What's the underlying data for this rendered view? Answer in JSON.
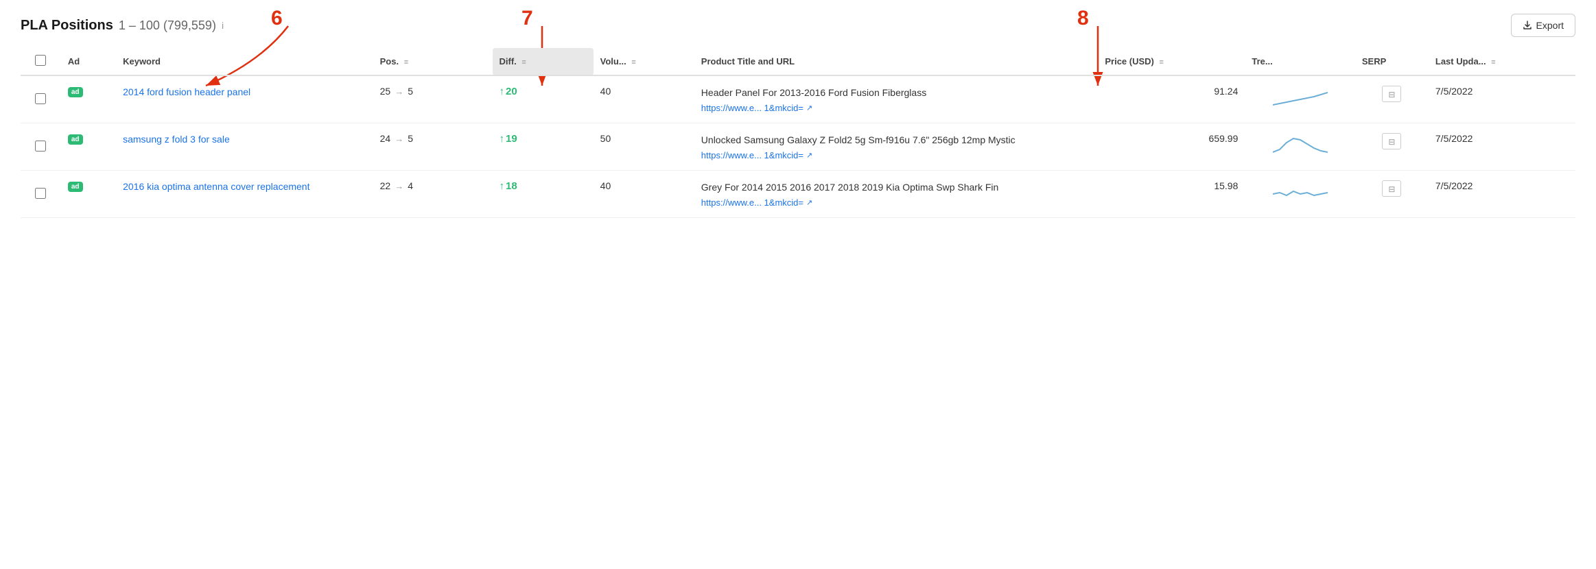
{
  "header": {
    "title": "PLA Positions",
    "range": "1 – 100 (799,559)",
    "info_label": "i",
    "export_label": "Export"
  },
  "annotations": {
    "six": "6",
    "seven": "7",
    "eight": "8"
  },
  "columns": [
    {
      "key": "check",
      "label": ""
    },
    {
      "key": "ad",
      "label": "Ad"
    },
    {
      "key": "keyword",
      "label": "Keyword"
    },
    {
      "key": "pos",
      "label": "Pos."
    },
    {
      "key": "diff",
      "label": "Diff."
    },
    {
      "key": "vol",
      "label": "Volu..."
    },
    {
      "key": "product",
      "label": "Product Title and URL"
    },
    {
      "key": "price",
      "label": "Price (USD)"
    },
    {
      "key": "trend",
      "label": "Tre..."
    },
    {
      "key": "serp",
      "label": "SERP"
    },
    {
      "key": "updated",
      "label": "Last Upda..."
    }
  ],
  "rows": [
    {
      "keyword": "2014 ford fusion header panel",
      "pos_from": "25",
      "pos_to": "5",
      "diff": "20",
      "vol": "40",
      "product_title": "Header Panel For 2013-2016 Ford Fusion Fiberglass",
      "product_url": "https://www.e... 1&mkcid=",
      "price": "91.24",
      "trend": "up-small",
      "date": "7/5/2022"
    },
    {
      "keyword": "samsung z fold 3 for sale",
      "pos_from": "24",
      "pos_to": "5",
      "diff": "19",
      "vol": "50",
      "product_title": "Unlocked Samsung Galaxy Z Fold2 5g Sm-f916u 7.6\" 256gb 12mp Mystic",
      "product_url": "https://www.e... 1&mkcid=",
      "price": "659.99",
      "trend": "hump",
      "date": "7/5/2022"
    },
    {
      "keyword": "2016 kia optima antenna cover replacement",
      "pos_from": "22",
      "pos_to": "4",
      "diff": "18",
      "vol": "40",
      "product_title": "Grey For 2014 2015 2016 2017 2018 2019 Kia Optima Swp Shark Fin",
      "product_url": "https://www.e... 1&mkcid=",
      "price": "15.98",
      "trend": "wave",
      "date": "7/5/2022"
    }
  ]
}
